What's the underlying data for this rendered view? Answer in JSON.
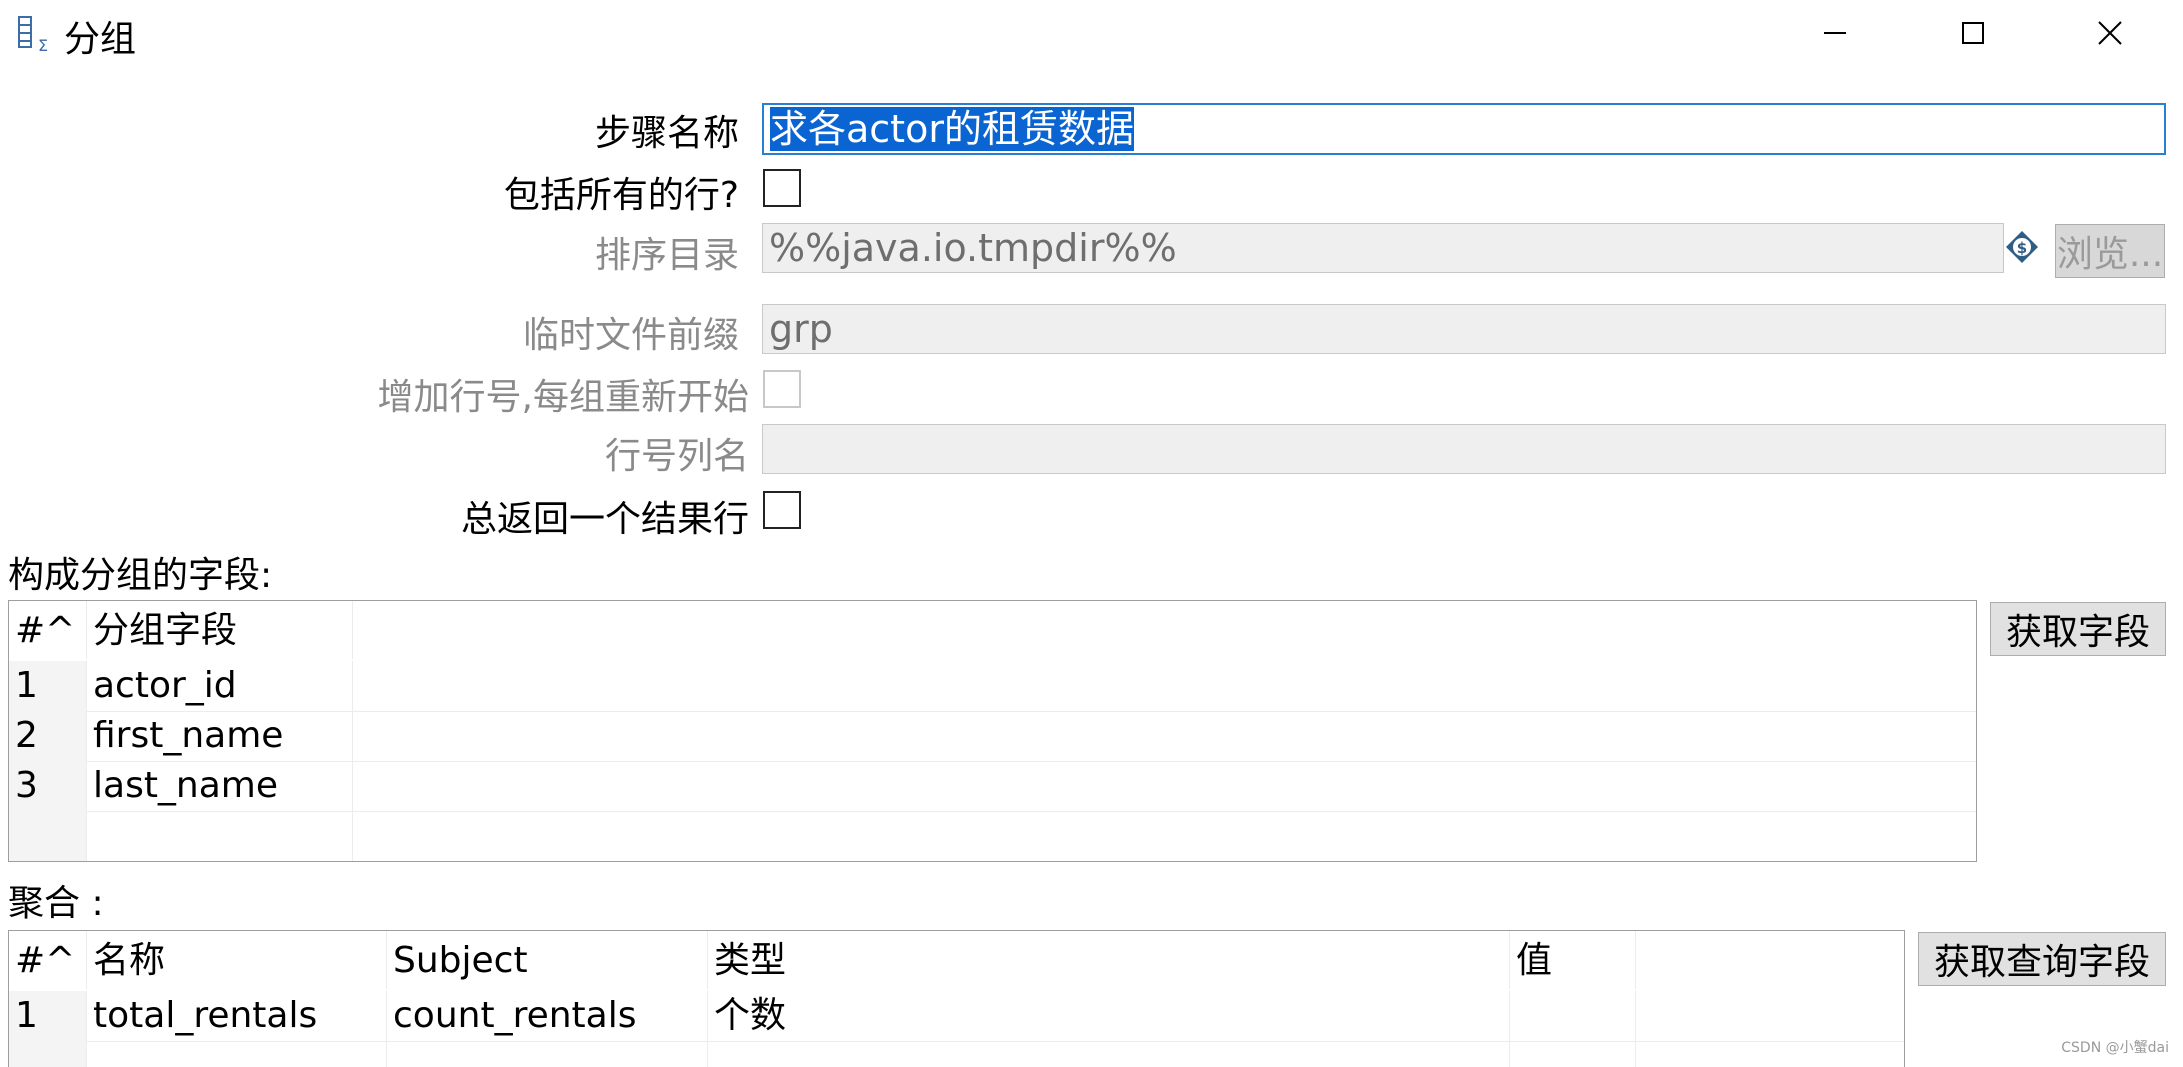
{
  "window": {
    "title": "分组",
    "icon": "group-by-icon",
    "controls": [
      "minimize-icon",
      "maximize-icon",
      "close-icon"
    ]
  },
  "form": {
    "step_name_label": "步骤名称",
    "step_name_value": "求各actor的租赁数据",
    "include_all_rows_label": "包括所有的行?",
    "sort_dir_label": "排序目录",
    "sort_dir_value": "%%java.io.tmpdir%%",
    "variable_icon": "dollar-variable-icon",
    "browse_label": "浏览...",
    "tmp_prefix_label": "临时文件前缀",
    "tmp_prefix_value": "grp",
    "add_line_number_label": "增加行号,每组重新开始",
    "line_number_field_label": "行号列名",
    "line_number_field_value": "",
    "always_one_row_label": "总返回一个结果行"
  },
  "group_section": {
    "title": "构成分组的字段:",
    "get_fields_label": "获取字段",
    "columns": [
      "#^",
      "分组字段"
    ],
    "rows": [
      {
        "num": "1",
        "field": "actor_id"
      },
      {
        "num": "2",
        "field": "first_name"
      },
      {
        "num": "3",
        "field": "last_name"
      }
    ]
  },
  "agg_section": {
    "title": "聚合 :",
    "get_lookup_label": "获取查询字段",
    "columns": [
      "#^",
      "名称",
      "Subject",
      "类型",
      "值"
    ],
    "rows": [
      {
        "num": "1",
        "name": "total_rentals",
        "subject": "count_rentals",
        "type": "个数",
        "value": ""
      }
    ]
  },
  "watermark": "CSDN @小蟹dai"
}
